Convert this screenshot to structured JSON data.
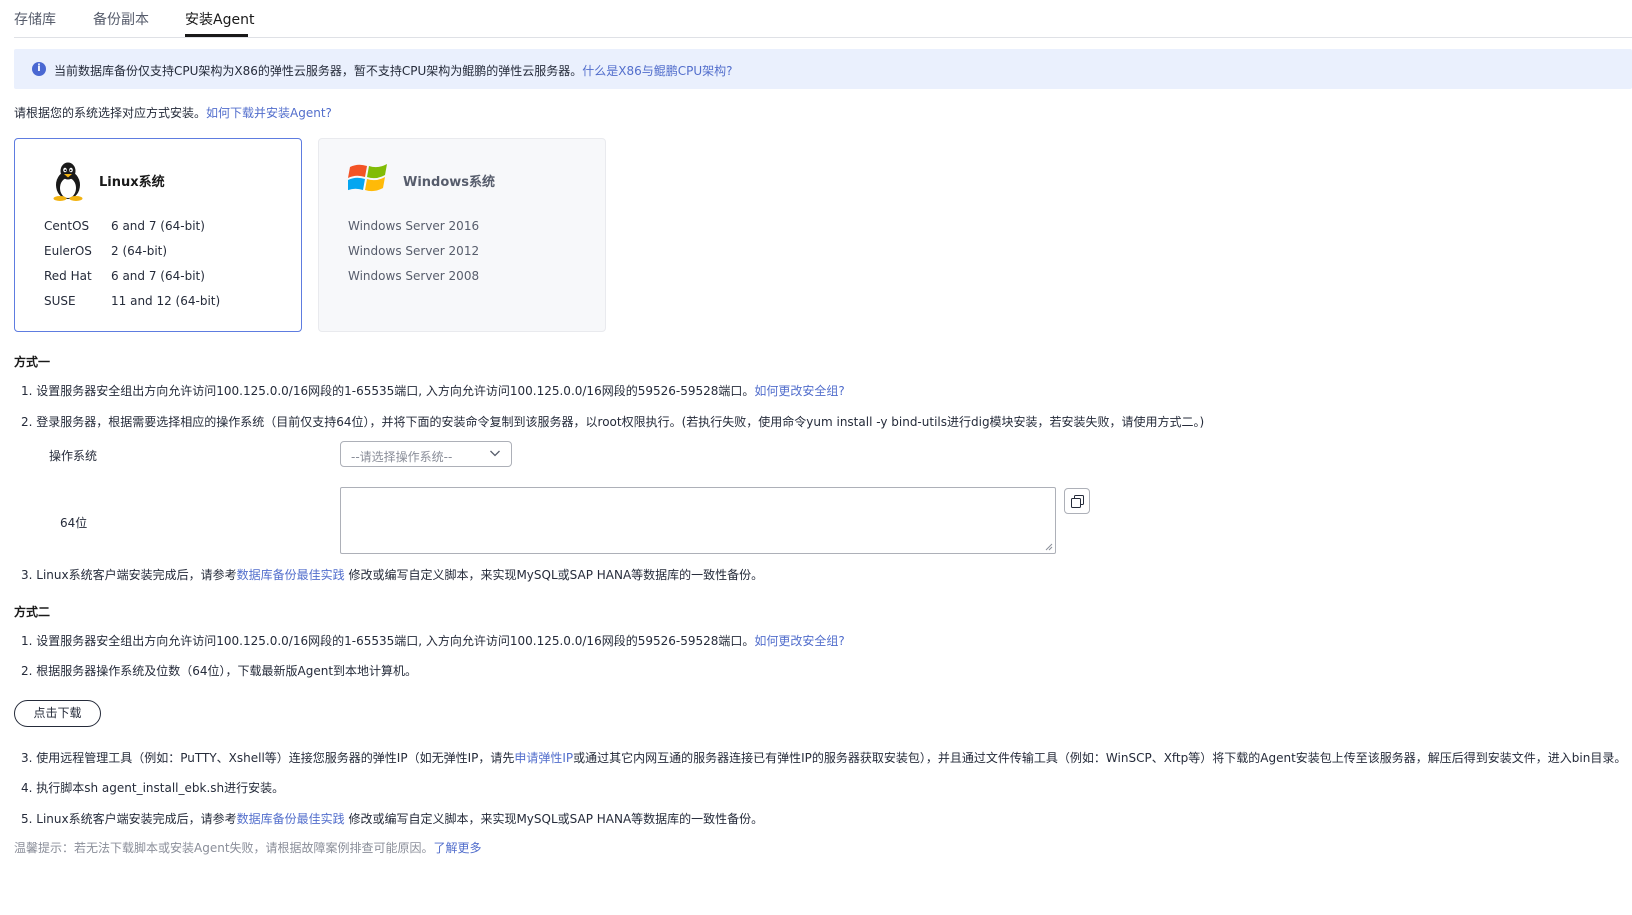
{
  "tabs": [
    {
      "label": "存储库"
    },
    {
      "label": "备份副本"
    },
    {
      "label": "安装Agent",
      "active": true
    }
  ],
  "info": {
    "text": "当前数据库备份仅支持CPU架构为X86的弹性云服务器，暂不支持CPU架构为鲲鹏的弹性云服务器。",
    "link": "什么是X86与鲲鹏CPU架构?"
  },
  "hint": {
    "text": "请根据您的系统选择对应方式安装。",
    "link": "如何下载并安装Agent?"
  },
  "linux_card": {
    "title": "Linux系统",
    "icon": "tux-penguin-icon",
    "rows": [
      {
        "name": "CentOS",
        "version": "6 and 7 (64-bit)"
      },
      {
        "name": "EulerOS",
        "version": "2 (64-bit)"
      },
      {
        "name": "Red Hat",
        "version": "6 and 7 (64-bit)"
      },
      {
        "name": "SUSE",
        "version": "11 and 12 (64-bit)"
      }
    ]
  },
  "windows_card": {
    "title": "Windows系统",
    "icon": "windows-flag-icon",
    "rows": [
      "Windows Server 2016",
      "Windows Server 2012",
      "Windows Server 2008"
    ]
  },
  "method1": {
    "title": "方式一",
    "step1": {
      "text": "1.  设置服务器安全组出方向允许访问100.125.0.0/16网段的1-65535端口, 入方向允许访问100.125.0.0/16网段的59526-59528端口。",
      "link": "如何更改安全组?"
    },
    "step2": {
      "text": "2.  登录服务器，根据需要选择相应的操作系统（目前仅支持64位），并将下面的安装命令复制到该服务器，以root权限执行。(若执行失败，使用命令yum install -y bind-utils进行dig模块安装，若安装失败，请使用方式二。)"
    },
    "os_label": "操作系统",
    "os_placeholder": "--请选择操作系统--",
    "bit_label": "64位",
    "command_value": "",
    "step3": {
      "pre": "3.  Linux系统客户端安装完成后，请参考",
      "link": "数据库备份最佳实践",
      "post": " 修改或编写自定义脚本，来实现MySQL或SAP HANA等数据库的一致性备份。"
    }
  },
  "method2": {
    "title": "方式二",
    "step1": {
      "text": "1.  设置服务器安全组出方向允许访问100.125.0.0/16网段的1-65535端口, 入方向允许访问100.125.0.0/16网段的59526-59528端口。",
      "link": "如何更改安全组?"
    },
    "step2": {
      "text": "2.  根据服务器操作系统及位数（64位），下载最新版Agent到本地计算机。"
    },
    "download_label": "点击下载",
    "step3": {
      "pre": "3.  使用远程管理工具（例如：PuTTY、Xshell等）连接您服务器的弹性IP（如无弹性IP，请先",
      "link": "申请弹性IP",
      "post": "或通过其它内网互通的服务器连接已有弹性IP的服务器获取安装包），并且通过文件传输工具（例如：WinSCP、Xftp等）将下载的Agent安装包上传至该服务器，解压后得到安装文件，进入bin目录。"
    },
    "step4": {
      "text": "4.  执行脚本sh agent_install_ebk.sh进行安装。"
    },
    "step5": {
      "pre": "5.  Linux系统客户端安装完成后，请参考",
      "link": "数据库备份最佳实践",
      "post": " 修改或编写自定义脚本，来实现MySQL或SAP HANA等数据库的一致性备份。"
    }
  },
  "tip": {
    "text": "温馨提示：若无法下载脚本或安装Agent失败，请根据故障案例排查可能原因。",
    "link": "了解更多"
  },
  "colors": {
    "link": "#526ecc",
    "selected_border": "#5e7ce0",
    "info_bg": "#eaf0fd",
    "info_icon": "#4a68d2"
  }
}
